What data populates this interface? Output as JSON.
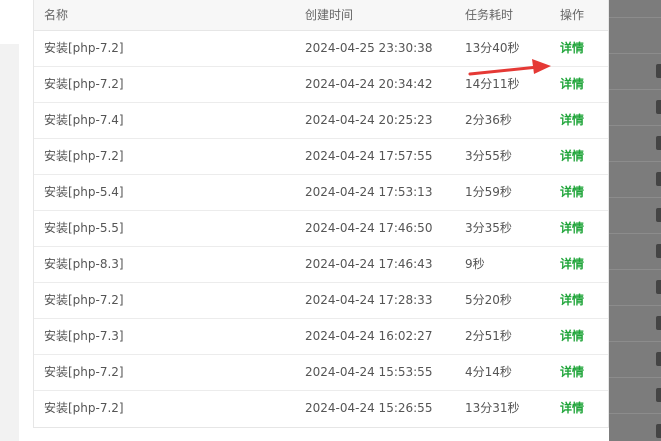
{
  "table": {
    "headers": {
      "name": "名称",
      "time": "创建时间",
      "duration": "任务耗时",
      "action": "操作"
    },
    "rows": [
      {
        "name": "安装[php-7.2]",
        "time": "2024-04-25 23:30:38",
        "duration": "13分40秒",
        "action": "详情"
      },
      {
        "name": "安装[php-7.2]",
        "time": "2024-04-24 20:34:42",
        "duration": "14分11秒",
        "action": "详情"
      },
      {
        "name": "安装[php-7.4]",
        "time": "2024-04-24 20:25:23",
        "duration": "2分36秒",
        "action": "详情"
      },
      {
        "name": "安装[php-7.2]",
        "time": "2024-04-24 17:57:55",
        "duration": "3分55秒",
        "action": "详情"
      },
      {
        "name": "安装[php-5.4]",
        "time": "2024-04-24 17:53:13",
        "duration": "1分59秒",
        "action": "详情"
      },
      {
        "name": "安装[php-5.5]",
        "time": "2024-04-24 17:46:50",
        "duration": "3分35秒",
        "action": "详情"
      },
      {
        "name": "安装[php-8.3]",
        "time": "2024-04-24 17:46:43",
        "duration": "9秒",
        "action": "详情"
      },
      {
        "name": "安装[php-7.2]",
        "time": "2024-04-24 17:28:33",
        "duration": "5分20秒",
        "action": "详情"
      },
      {
        "name": "安装[php-7.3]",
        "time": "2024-04-24 16:02:27",
        "duration": "2分51秒",
        "action": "详情"
      },
      {
        "name": "安装[php-7.2]",
        "time": "2024-04-24 15:53:55",
        "duration": "4分14秒",
        "action": "详情"
      },
      {
        "name": "安装[php-7.2]",
        "time": "2024-04-24 15:26:55",
        "duration": "13分31秒",
        "action": "详情"
      }
    ]
  },
  "colors": {
    "accent": "#20a53a",
    "arrow": "#e53935"
  },
  "icons": {
    "annotation": "red-arrow-icon"
  }
}
